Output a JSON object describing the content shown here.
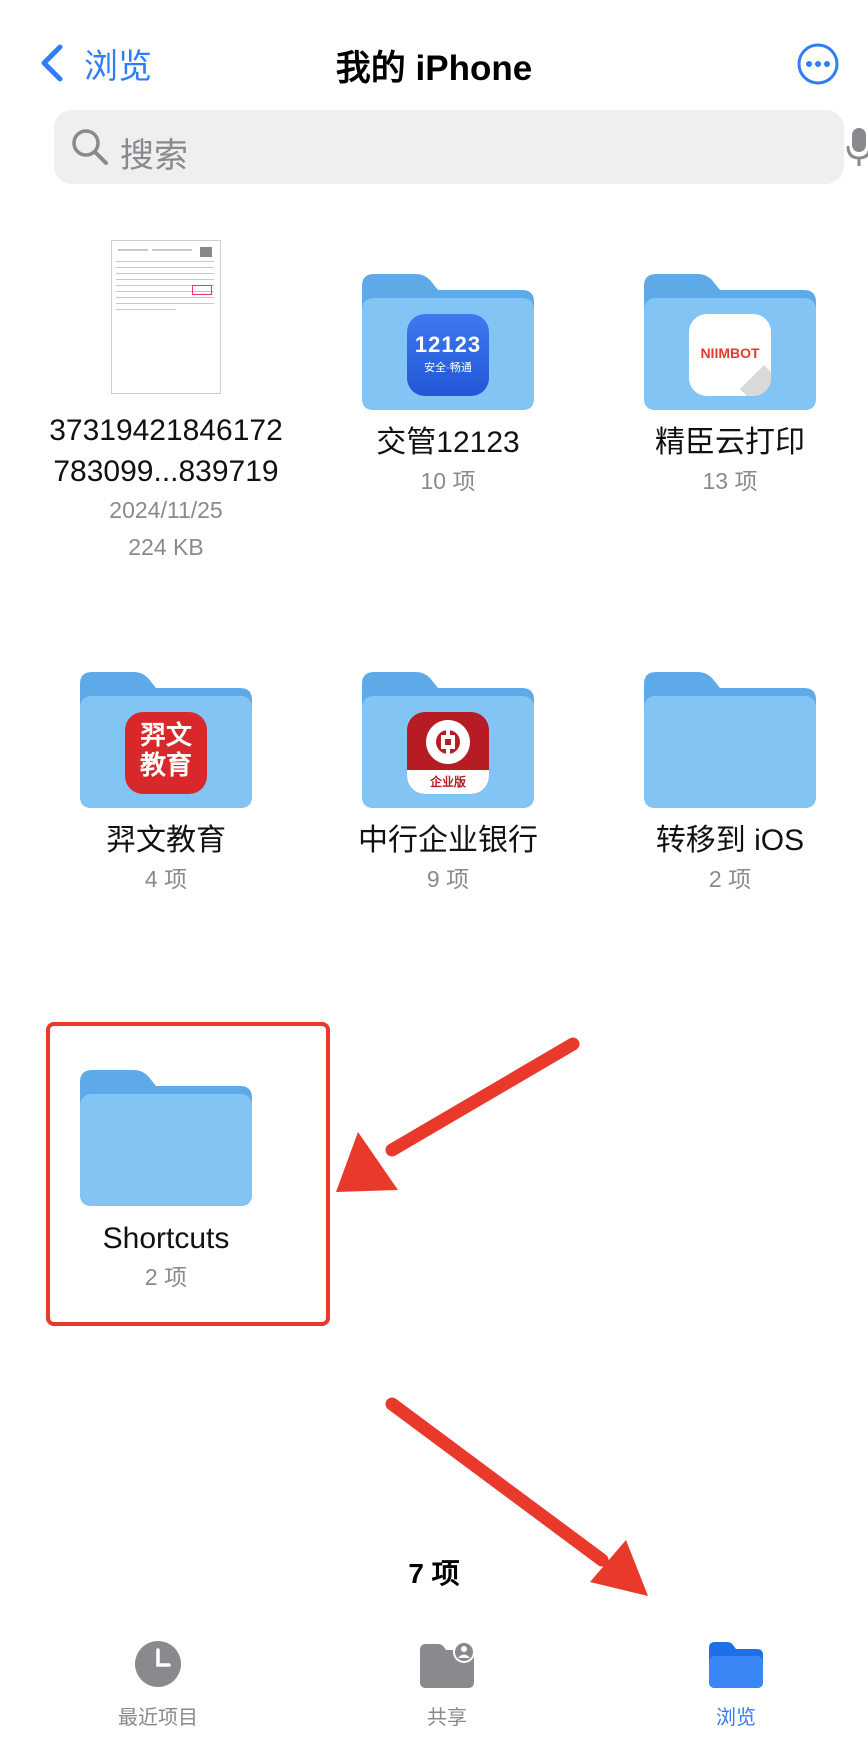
{
  "nav": {
    "back_label": "浏览",
    "title": "我的 iPhone"
  },
  "search": {
    "placeholder": "搜索"
  },
  "items": [
    {
      "name": "37319421846172\n783099...839719",
      "date": "2024/11/25",
      "size": "224 KB",
      "type": "document"
    },
    {
      "name": "交管12123",
      "count": "10 项",
      "icon": "12123-app-icon",
      "icon_text": "12123",
      "icon_subtext": "安全·畅通"
    },
    {
      "name": "精臣云打印",
      "count": "13 项",
      "icon": "niimbot-app-icon",
      "icon_text": "NIIMBOT"
    },
    {
      "name": "羿文教育",
      "count": "4 项",
      "icon": "yiwen-app-icon",
      "icon_text": "羿文\n教育"
    },
    {
      "name": "中行企业银行",
      "count": "9 项",
      "icon": "boc-app-icon",
      "icon_text": "企业版"
    },
    {
      "name": "转移到 iOS",
      "count": "2 项"
    },
    {
      "name": "Shortcuts",
      "count": "2 项"
    }
  ],
  "footer": {
    "count": "7 项"
  },
  "tabs": [
    {
      "label": "最近项目",
      "icon": "clock-icon",
      "active": false
    },
    {
      "label": "共享",
      "icon": "shared-folder-icon",
      "active": false
    },
    {
      "label": "浏览",
      "icon": "folder-icon",
      "active": true
    }
  ],
  "colors": {
    "accent": "#2f7ef6",
    "folder": "#7cc0f2",
    "annotation": "#e8392b"
  }
}
